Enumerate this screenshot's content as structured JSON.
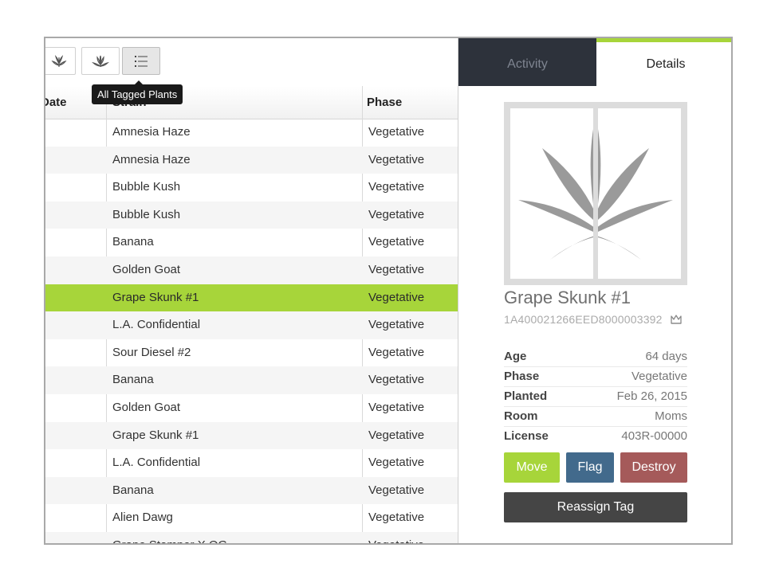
{
  "toolbar": {
    "tooltip": "All Tagged Plants",
    "buttons": [
      {
        "icon": "leaf-icon"
      },
      {
        "icon": "leaves-icon"
      },
      {
        "icon": "list-icon"
      }
    ]
  },
  "table": {
    "headers": {
      "date": "Date",
      "strain": "Strain",
      "phase": "Phase"
    },
    "rows": [
      {
        "strain": "Amnesia Haze",
        "phase": "Vegetative"
      },
      {
        "strain": "Amnesia Haze",
        "phase": "Vegetative"
      },
      {
        "strain": "Bubble Kush",
        "phase": "Vegetative"
      },
      {
        "strain": "Bubble Kush",
        "phase": "Vegetative"
      },
      {
        "strain": "Banana",
        "phase": "Vegetative"
      },
      {
        "strain": "Golden Goat",
        "phase": "Vegetative"
      },
      {
        "strain": "Grape Skunk #1",
        "phase": "Vegetative",
        "selected": true
      },
      {
        "strain": "L.A. Confidential",
        "phase": "Vegetative"
      },
      {
        "strain": "Sour Diesel #2",
        "phase": "Vegetative"
      },
      {
        "strain": "Banana",
        "phase": "Vegetative"
      },
      {
        "strain": "Golden Goat",
        "phase": "Vegetative"
      },
      {
        "strain": "Grape Skunk #1",
        "phase": "Vegetative"
      },
      {
        "strain": "L.A. Confidential",
        "phase": "Vegetative"
      },
      {
        "strain": "Banana",
        "phase": "Vegetative"
      },
      {
        "strain": "Alien Dawg",
        "phase": "Vegetative"
      },
      {
        "strain": "Grape Stomper X OG",
        "phase": "Vegetative"
      }
    ]
  },
  "tabs": {
    "activity": "Activity",
    "details": "Details"
  },
  "details": {
    "name": "Grape Skunk #1",
    "tag": "1A400021266EED8000003392",
    "tag_icon": "crown-icon",
    "info": {
      "age": {
        "label": "Age",
        "value": "64 days"
      },
      "phase": {
        "label": "Phase",
        "value": "Vegetative"
      },
      "planted": {
        "label": "Planted",
        "value": "Feb 26, 2015"
      },
      "room": {
        "label": "Room",
        "value": "Moms"
      },
      "license": {
        "label": "License",
        "value": "403R-00000"
      }
    },
    "buttons": {
      "move": "Move",
      "flag": "Flag",
      "destroy": "Destroy",
      "reassign": "Reassign Tag"
    }
  },
  "colors": {
    "accent": "#a7d53a",
    "flag": "#426a8c",
    "destroy": "#a55a5a",
    "reassign": "#454545",
    "tab_dark": "#2d323b"
  }
}
